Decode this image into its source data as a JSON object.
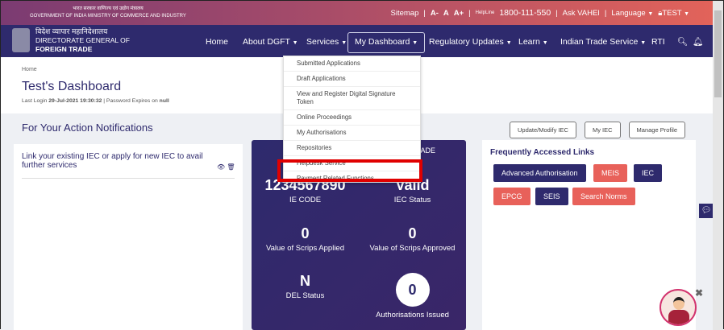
{
  "topbar": {
    "gov_hindi": "भारत सरकार  वाणिज्य एवं उद्योग मंत्रालय",
    "gov_en": "GOVERNMENT OF INDIA   MINISTRY OF COMMERCE AND INDUSTRY",
    "sitemap": "Sitemap",
    "sep": "|",
    "a_minus": "A-",
    "a": "A",
    "a_plus": "A+",
    "helpline": "HelpLine",
    "phone": "1800-111-550",
    "ask": "Ask VAHEI",
    "language": "Language",
    "user": "TEST"
  },
  "brand": {
    "hindi": "विदेश व्यापार महानिदेशालय",
    "line1": "DIRECTORATE GENERAL OF",
    "line2": "FOREIGN TRADE"
  },
  "nav": {
    "items": [
      "Home",
      "About DGFT",
      "Services",
      "My Dashboard",
      "Regulatory Updates",
      "Learn",
      "Indian Trade Service",
      "RTI"
    ],
    "active": "My Dashboard"
  },
  "dropdown": {
    "items": [
      "Submitted Applications",
      "Draft Applications",
      "View and Register Digital Signature Token",
      "Online Proceedings",
      "My Authorisations",
      "Repositories",
      "Helpdesk Service",
      "Payment Related Functions"
    ],
    "highlighted": "Payment Related Functions",
    "highlight_color": "#e00000"
  },
  "page": {
    "breadcrumb": "Home",
    "title": "Test's Dashboard",
    "last_login_label": "Last Login",
    "last_login": "29-Jul-2021 19:30:32",
    "password_label": "| Password Expires on",
    "password_value": "null",
    "notifications_title": "For Your Action Notifications"
  },
  "notification": {
    "text": "Link your existing IEC or apply for new IEC to avail further services"
  },
  "stats": {
    "ade": "ADE",
    "ie_code": "1234567890",
    "ie_code_label": "IE CODE",
    "iec_status": "Valid",
    "iec_status_label": "IEC Status",
    "scrips_applied": "0",
    "scrips_applied_label": "Value of Scrips Applied",
    "scrips_approved": "0",
    "scrips_approved_label": "Value of Scrips Approved",
    "del_status": "N",
    "del_status_label": "DEL Status",
    "auth_issued": "0",
    "auth_issued_label": "Authorisations Issued"
  },
  "actions": {
    "update": "Update/Modify IEC",
    "my_iec": "My IEC",
    "profile": "Manage Profile"
  },
  "links": {
    "title": "Frequently Accessed Links",
    "items": [
      "Advanced Authorisation",
      "MEIS",
      "IEC",
      "EPCG",
      "SEIS",
      "Search Norms"
    ]
  },
  "colors": {
    "navy": "#2e2a6d",
    "coral": "#e8615a"
  }
}
